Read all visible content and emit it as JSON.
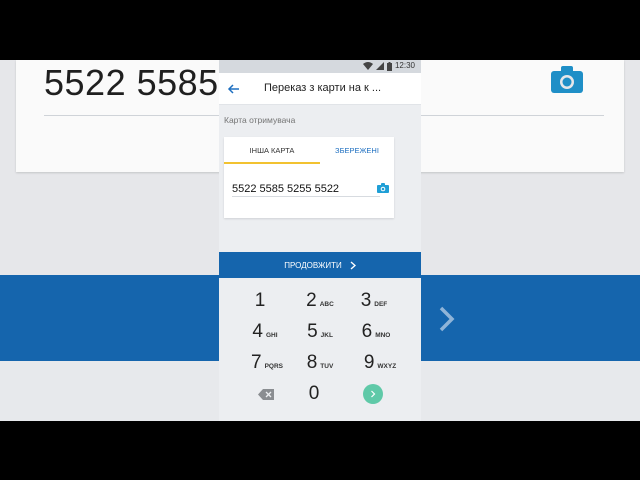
{
  "background": {
    "card_number": "5522 5585"
  },
  "statusbar": {
    "time": "12:30"
  },
  "appbar": {
    "title": "Переказ з карти на к ..."
  },
  "form": {
    "section_label": "Карта отримувача",
    "tabs": [
      {
        "label": "ІНША КАРТА",
        "active": true
      },
      {
        "label": "ЗБЕРЕЖЕНІ",
        "active": false
      }
    ],
    "card_number_value": "5522 5585 5255 5522"
  },
  "continue_button": {
    "label": "ПРОДОВЖИТИ"
  },
  "keypad": {
    "keys": [
      {
        "num": "1",
        "letters": ""
      },
      {
        "num": "2",
        "letters": "ABC"
      },
      {
        "num": "3",
        "letters": "DEF"
      },
      {
        "num": "4",
        "letters": "GHI"
      },
      {
        "num": "5",
        "letters": "JKL"
      },
      {
        "num": "6",
        "letters": "MNO"
      },
      {
        "num": "7",
        "letters": "PQRS"
      },
      {
        "num": "8",
        "letters": "TUV"
      },
      {
        "num": "9",
        "letters": "WXYZ"
      },
      {
        "num": "0",
        "letters": ""
      }
    ]
  },
  "colors": {
    "primary_blue": "#1565ad",
    "tab_accent": "#f2c230",
    "go_button": "#5fc9a8",
    "link_blue": "#1e6fc0"
  }
}
